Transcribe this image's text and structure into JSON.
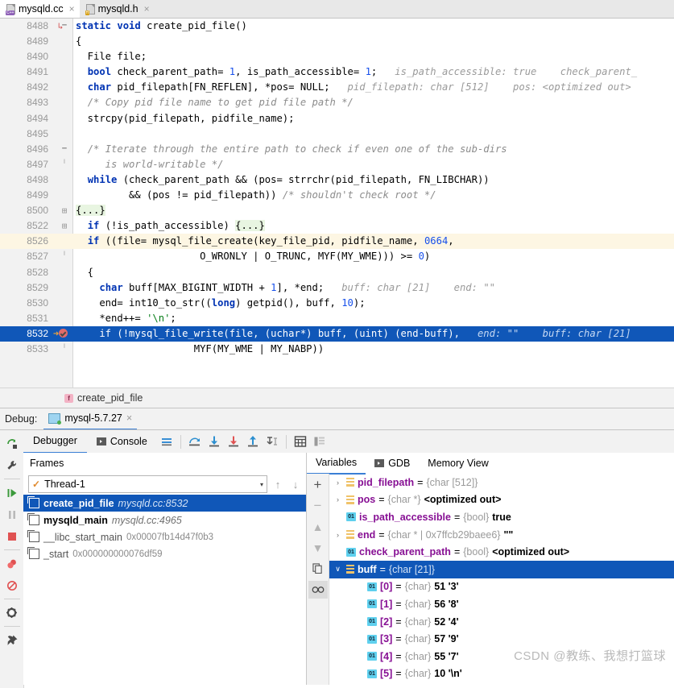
{
  "editor": {
    "tabs": [
      {
        "label": "mysqld.cc",
        "icon": "cpp-file-icon",
        "badge": "C++",
        "active": true
      },
      {
        "label": "mysqld.h",
        "icon": "h-file-icon",
        "badge": "H",
        "active": false
      }
    ],
    "lines": [
      {
        "num": "8488",
        "marker": "arrow-red",
        "fold": "minus",
        "current": false,
        "selected": false,
        "html": "<span class=\"kw\">static</span> <span class=\"kw\">void</span> create_pid_file()"
      },
      {
        "num": "8489",
        "marker": "",
        "fold": "",
        "current": false,
        "selected": false,
        "html": "{"
      },
      {
        "num": "8490",
        "marker": "",
        "fold": "",
        "current": false,
        "selected": false,
        "html": "  File file;"
      },
      {
        "num": "8491",
        "marker": "",
        "fold": "",
        "current": false,
        "selected": false,
        "html": "  <span class=\"kw\">bool</span> check_parent_path= <span class=\"num2\">1</span>, is_path_accessible= <span class=\"num2\">1</span>;   <span class=\"inlay\">is_path_accessible: true    check_parent_</span>"
      },
      {
        "num": "8492",
        "marker": "",
        "fold": "",
        "current": false,
        "selected": false,
        "html": "  <span class=\"kw\">char</span> pid_filepath[FN_REFLEN], *pos= NULL;   <span class=\"inlay\">pid_filepath: char [512]    pos: &lt;optimized out&gt;</span>"
      },
      {
        "num": "8493",
        "marker": "",
        "fold": "",
        "current": false,
        "selected": false,
        "html": "  <span class=\"cmt\">/* Copy pid file name to get pid file path */</span>"
      },
      {
        "num": "8494",
        "marker": "",
        "fold": "",
        "current": false,
        "selected": false,
        "html": "  strcpy(pid_filepath, pidfile_name);"
      },
      {
        "num": "8495",
        "marker": "",
        "fold": "",
        "current": false,
        "selected": false,
        "html": ""
      },
      {
        "num": "8496",
        "marker": "",
        "fold": "minus",
        "current": false,
        "selected": false,
        "html": "  <span class=\"cmt\">/* Iterate through the entire path to check if even one of the sub-dirs</span>"
      },
      {
        "num": "8497",
        "marker": "",
        "fold": "minus2",
        "current": false,
        "selected": false,
        "html": "<span class=\"cmt\">     is world-writable */</span>"
      },
      {
        "num": "8498",
        "marker": "",
        "fold": "",
        "current": false,
        "selected": false,
        "html": "  <span class=\"kw\">while</span> (check_parent_path &amp;&amp; (pos= strrchr(pid_filepath, FN_LIBCHAR))"
      },
      {
        "num": "8499",
        "marker": "",
        "fold": "",
        "current": false,
        "selected": false,
        "html": "         &amp;&amp; (pos != pid_filepath)) <span class=\"cmt\">/* shouldn't check root */</span>"
      },
      {
        "num": "8500",
        "marker": "",
        "fold": "plus",
        "current": false,
        "selected": false,
        "html": "<span class=\"folded\">{...}</span>"
      },
      {
        "num": "8522",
        "marker": "",
        "fold": "plus",
        "current": false,
        "selected": false,
        "html": "  <span class=\"kw\">if</span> (!is_path_accessible) <span class=\"folded\">{...}</span>"
      },
      {
        "num": "8526",
        "marker": "",
        "fold": "",
        "current": true,
        "selected": false,
        "html": "  <span class=\"kw\">if</span> ((file= mysql_file_create(key_file_pid, pidfile_name, <span class=\"num2\">0664</span>,"
      },
      {
        "num": "8527",
        "marker": "",
        "fold": "minus2",
        "current": false,
        "selected": false,
        "html": "                     O_WRONLY | O_TRUNC, MYF(MY_WME))) &gt;= <span class=\"num2\">0</span>)"
      },
      {
        "num": "8528",
        "marker": "",
        "fold": "",
        "current": false,
        "selected": false,
        "html": "  {"
      },
      {
        "num": "8529",
        "marker": "",
        "fold": "",
        "current": false,
        "selected": false,
        "html": "    <span class=\"kw\">char</span> buff[MAX_BIGINT_WIDTH + <span class=\"num2\">1</span>], *end;   <span class=\"inlay\">buff: char [21]    end: \"\"</span>"
      },
      {
        "num": "8530",
        "marker": "",
        "fold": "",
        "current": false,
        "selected": false,
        "html": "    end= int10_to_str((<span class=\"kw\">long</span>) getpid(), buff, <span class=\"num2\">10</span>);"
      },
      {
        "num": "8531",
        "marker": "",
        "fold": "",
        "current": false,
        "selected": false,
        "html": "    *end++= <span class=\"str\">'\\n'</span>;"
      },
      {
        "num": "8532",
        "marker": "breakpoint",
        "fold": "",
        "current": false,
        "selected": true,
        "html": "    if (!mysql_file_write(file, (uchar*) buff, (uint) (end-buff),   <span class=\"inlay\">end: \"\"    buff: char [21]</span>"
      },
      {
        "num": "8533",
        "marker": "",
        "fold": "minus2",
        "current": false,
        "selected": false,
        "html": "                    MYF(MY_WME | MY_NABP))"
      }
    ],
    "breadcrumb": {
      "icon": "function-icon",
      "label": "create_pid_file"
    }
  },
  "debug": {
    "header_label": "Debug:",
    "session_tab": {
      "label": "mysql-5.7.27",
      "icon": "run-config-icon",
      "close": "×"
    },
    "tabs": [
      {
        "label": "Debugger",
        "icon": "",
        "active": true
      },
      {
        "label": "Console",
        "icon": "console-icon",
        "active": false
      }
    ],
    "toolbar_icons": [
      "mute-breakpoints-icon",
      "step-over-icon",
      "step-into-icon",
      "force-step-into-icon",
      "step-out-icon",
      "run-to-cursor-icon",
      "evaluate-expression-icon",
      "show-values-inline-icon"
    ],
    "side_icons": [
      "rerun-icon",
      "settings-wrench-icon",
      "resume-program-icon",
      "pause-program-icon",
      "stop-icon",
      "view-breakpoints-icon",
      "mute-breakpoints-icon",
      "settings-gear-icon",
      "pin-icon"
    ],
    "frames": {
      "title": "Frames",
      "thread": {
        "label": "Thread-1",
        "status_icon": "check-icon",
        "chevron": "▾"
      },
      "nav": {
        "up": "↑",
        "down": "↓"
      },
      "items": [
        {
          "name": "create_pid_file",
          "loc": "mysqld.cc:8532",
          "addr": "",
          "selected": true,
          "dim": false
        },
        {
          "name": "mysqld_main",
          "loc": "mysqld.cc:4965",
          "addr": "",
          "selected": false,
          "dim": false
        },
        {
          "name": "__libc_start_main",
          "loc": "",
          "addr": "0x00007fb14d47f0b3",
          "selected": false,
          "dim": true
        },
        {
          "name": "_start",
          "loc": "",
          "addr": "0x000000000076df59",
          "selected": false,
          "dim": true
        }
      ]
    },
    "variables": {
      "tabs": [
        {
          "label": "Variables",
          "icon": "",
          "active": true
        },
        {
          "label": "GDB",
          "icon": "console-icon",
          "active": false
        },
        {
          "label": "Memory View",
          "icon": "",
          "active": false
        }
      ],
      "tool_icons": [
        "add-watch-icon",
        "remove-watch-icon",
        "move-up-icon",
        "move-down-icon",
        "copy-icon",
        "inspect-icon"
      ],
      "rows": [
        {
          "chevron": "›",
          "icon": "array",
          "name": "pid_filepath",
          "eq": " = ",
          "type": "{char [512]}",
          "value": "",
          "indent": 0,
          "selected": false
        },
        {
          "chevron": "›",
          "icon": "array",
          "name": "pos",
          "eq": " = ",
          "type": "{char *}",
          "value": "<optimized out>",
          "indent": 0,
          "selected": false
        },
        {
          "chevron": "",
          "icon": "prim",
          "name": "is_path_accessible",
          "eq": " = ",
          "type": "{bool}",
          "value": "true",
          "indent": 0,
          "selected": false
        },
        {
          "chevron": "›",
          "icon": "array",
          "name": "end",
          "eq": " = ",
          "type": "{char * | 0x7ffcb29baee6}",
          "value": "\"\"",
          "indent": 0,
          "selected": false
        },
        {
          "chevron": "",
          "icon": "prim",
          "name": "check_parent_path",
          "eq": " = ",
          "type": "{bool}",
          "value": "<optimized out>",
          "indent": 0,
          "selected": false
        },
        {
          "chevron": "∨",
          "icon": "array",
          "name": "buff",
          "eq": " = ",
          "type": "{char [21]}",
          "value": "",
          "indent": 0,
          "selected": true
        },
        {
          "chevron": "",
          "icon": "prim",
          "name": "[0]",
          "eq": " = ",
          "type": "{char}",
          "value": "51 '3'",
          "indent": 1,
          "selected": false
        },
        {
          "chevron": "",
          "icon": "prim",
          "name": "[1]",
          "eq": " = ",
          "type": "{char}",
          "value": "56 '8'",
          "indent": 1,
          "selected": false
        },
        {
          "chevron": "",
          "icon": "prim",
          "name": "[2]",
          "eq": " = ",
          "type": "{char}",
          "value": "52 '4'",
          "indent": 1,
          "selected": false
        },
        {
          "chevron": "",
          "icon": "prim",
          "name": "[3]",
          "eq": " = ",
          "type": "{char}",
          "value": "57 '9'",
          "indent": 1,
          "selected": false
        },
        {
          "chevron": "",
          "icon": "prim",
          "name": "[4]",
          "eq": " = ",
          "type": "{char}",
          "value": "55 '7'",
          "indent": 1,
          "selected": false
        },
        {
          "chevron": "",
          "icon": "prim",
          "name": "[5]",
          "eq": " = ",
          "type": "{char}",
          "value": "10 '\\n'",
          "indent": 1,
          "selected": false
        }
      ]
    }
  },
  "watermark": "CSDN @教练、我想打篮球",
  "colors": {
    "accent": "#3a7fd5",
    "selection": "#1057b8",
    "current_line": "#fdf6e3",
    "keyword": "#0033b3"
  }
}
